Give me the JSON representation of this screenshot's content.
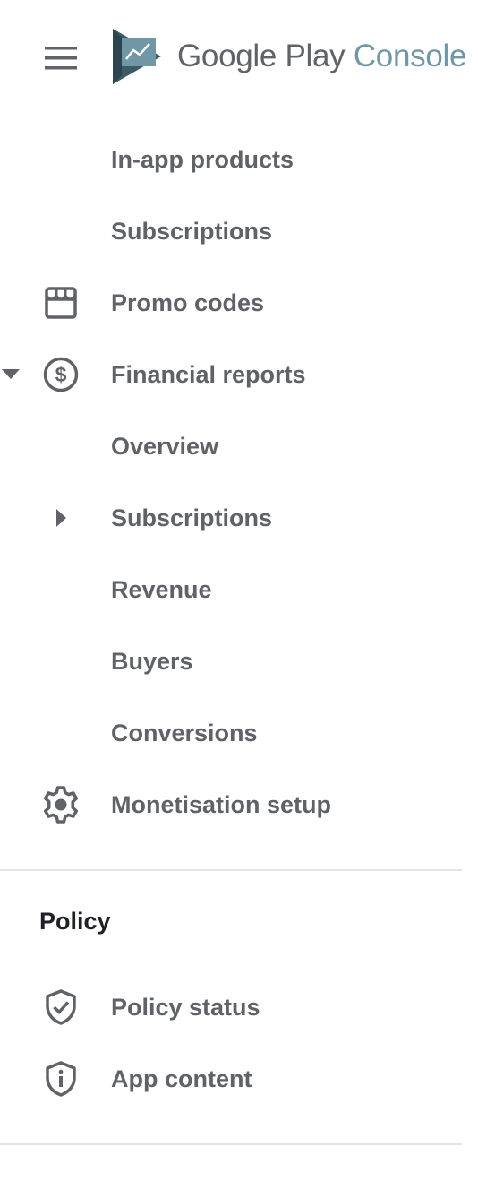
{
  "header": {
    "menu_icon": "hamburger-menu-icon",
    "logo_icon": "google-play-console-logo",
    "brand_google_play": "Google Play",
    "brand_console": "Console"
  },
  "nav": {
    "items": [
      {
        "label": "In-app products",
        "icon": null
      },
      {
        "label": "Subscriptions",
        "icon": null
      },
      {
        "label": "Promo codes",
        "icon": "storefront-icon"
      },
      {
        "label": "Financial reports",
        "icon": "dollar-circle-icon",
        "expanded": true
      },
      {
        "label": "Overview",
        "icon": null
      },
      {
        "label": "Subscriptions",
        "icon": null,
        "collapsed_children": true
      },
      {
        "label": "Revenue",
        "icon": null
      },
      {
        "label": "Buyers",
        "icon": null
      },
      {
        "label": "Conversions",
        "icon": null
      },
      {
        "label": "Monetisation setup",
        "icon": "gear-icon"
      }
    ]
  },
  "policy": {
    "title": "Policy",
    "items": [
      {
        "label": "Policy status",
        "icon": "shield-check-icon"
      },
      {
        "label": "App content",
        "icon": "shield-info-icon"
      }
    ]
  },
  "colors": {
    "text": "#5f6368",
    "heading": "#202124",
    "console_accent": "#6f97a5",
    "divider": "#e3e3e3"
  }
}
